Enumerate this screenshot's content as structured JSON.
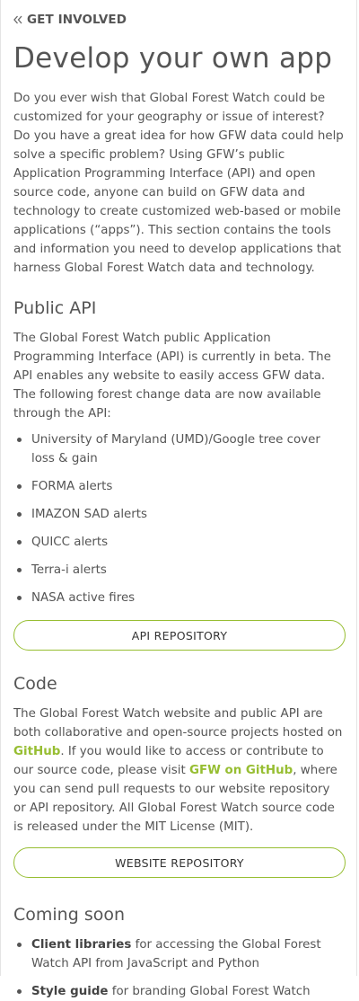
{
  "header": {
    "back_label": "GET INVOLVED",
    "back_icon": "double-chevron-left-icon"
  },
  "page": {
    "title": "Develop your own app",
    "intro": "Do you ever wish that Global Forest Watch could be customized for your geography or issue of interest? Do you have a great idea for how GFW data could help solve a specific problem? Using GFW’s public Application Programming Interface (API) and open source code, anyone can build on GFW data and technology to create customized web-based or mobile applications (“apps”). This section contains the tools and information you need to develop applications that harness Global Forest Watch data and technology."
  },
  "api_section": {
    "heading": "Public API",
    "body": "The Global Forest Watch public Application Programming Interface (API) is currently in beta. The API enables any website to easily access GFW data. The following forest change data are now available through the API:",
    "items": [
      "University of Maryland (UMD)/Google tree cover loss & gain",
      "FORMA alerts",
      "IMAZON SAD alerts",
      "QUICC alerts",
      "Terra-i alerts",
      "NASA active fires"
    ],
    "button_label": "API REPOSITORY"
  },
  "code_section": {
    "heading": "Code",
    "text_1": "The Global Forest Watch website and public API are both collaborative and open-source projects hosted on ",
    "link_1": "GitHub",
    "text_2": ". If you would like to access or contribute to our source code, please visit ",
    "link_2": "GFW on GitHub",
    "text_3": ", where you can send pull requests to our website repository or API repository. All Global Forest Watch source code is released under the MIT License (MIT).",
    "button_label": "WEBSITE REPOSITORY"
  },
  "soon_section": {
    "heading": "Coming soon",
    "items": [
      {
        "bold": "Client libraries",
        "rest": " for accessing the Global Forest Watch API from JavaScript and Python"
      },
      {
        "bold": "Style guide",
        "rest": " for branding Global Forest Watch"
      }
    ]
  },
  "colors": {
    "accent": "#97be32",
    "text": "#555555",
    "border": "#e4e4e4"
  }
}
